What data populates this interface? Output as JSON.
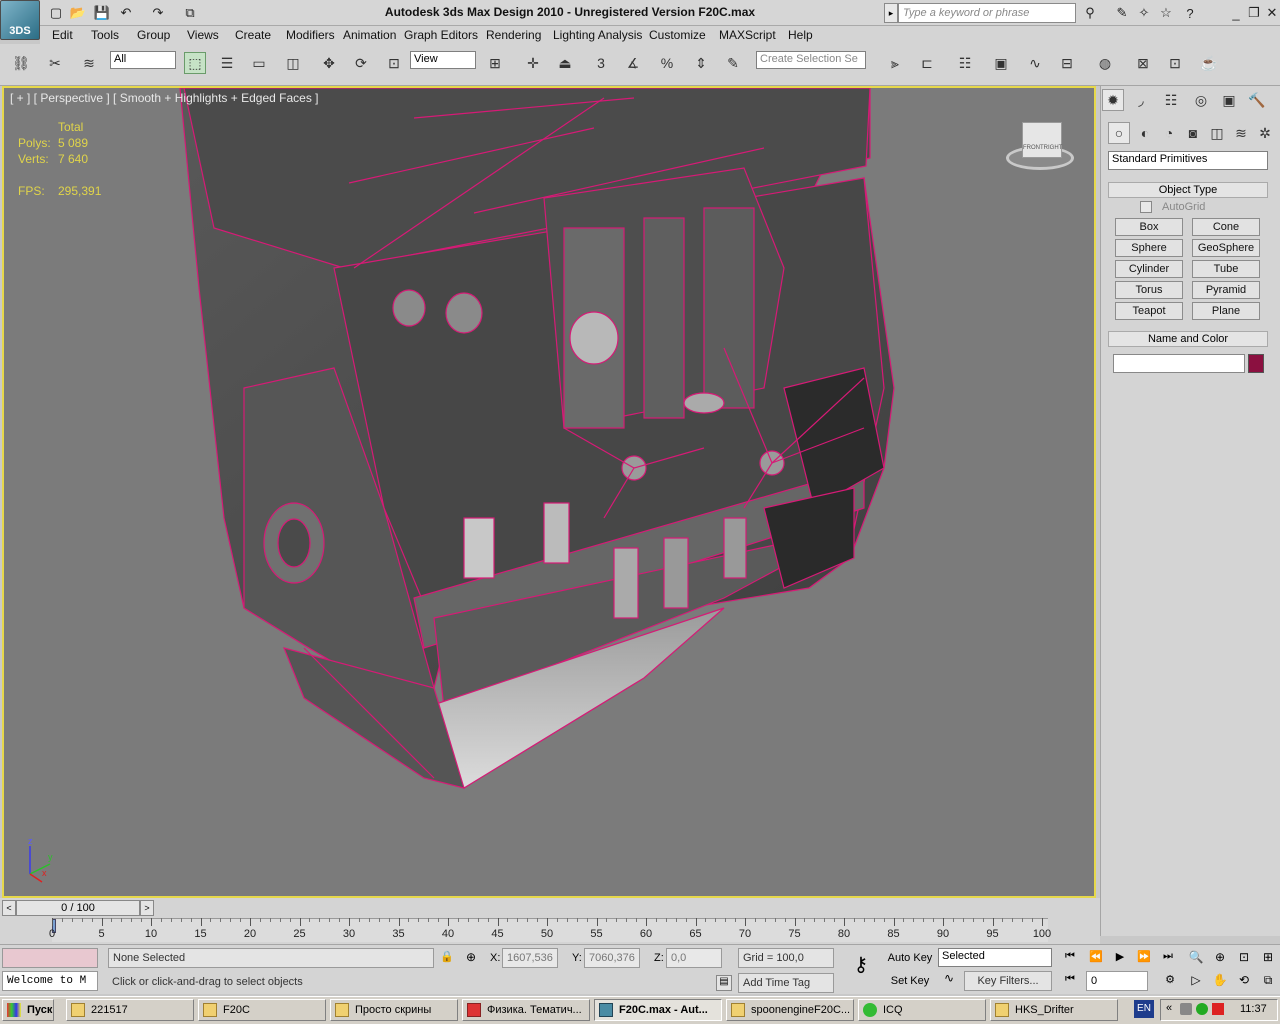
{
  "app": {
    "title": "Autodesk 3ds Max Design 2010  - Unregistered Version    F20C.max",
    "logo": "3DS",
    "search_placeholder": "Type a keyword or phrase"
  },
  "menu": [
    "Edit",
    "Tools",
    "Group",
    "Views",
    "Create",
    "Modifiers",
    "Animation",
    "Graph Editors",
    "Rendering",
    "Lighting Analysis",
    "Customize",
    "MAXScript",
    "Help"
  ],
  "toolbar": {
    "filter_value": "All",
    "refcoord_value": "View",
    "selection_set_placeholder": "Create Selection Se",
    "snap_label": "3",
    "angle_label": "%"
  },
  "viewport": {
    "label": "[ + ] [ Perspective ] [ Smooth + Highlights + Edged Faces ]",
    "stats": {
      "total_label": "Total",
      "polys_label": "Polys:",
      "polys_value": "5 089",
      "verts_label": "Verts:",
      "verts_value": "7 640",
      "fps_label": "FPS:",
      "fps_value": "295,391"
    },
    "viewcube_labels": [
      "FRONT",
      "RIGHT"
    ],
    "axis": {
      "x": "x",
      "y": "y",
      "z": "z"
    }
  },
  "command_panel": {
    "category": "Standard Primitives",
    "object_type_title": "Object Type",
    "autogrid_label": "AutoGrid",
    "buttons": [
      "Box",
      "Cone",
      "Sphere",
      "GeoSphere",
      "Cylinder",
      "Tube",
      "Torus",
      "Pyramid",
      "Teapot",
      "Plane"
    ],
    "name_color_title": "Name and Color",
    "name_value": "",
    "color": "#8b1040"
  },
  "timeline": {
    "frame_label": "0 / 100",
    "ticks": [
      "0",
      "5",
      "10",
      "15",
      "20",
      "25",
      "30",
      "35",
      "40",
      "45",
      "50",
      "55",
      "60",
      "65",
      "70",
      "75",
      "80",
      "85",
      "90",
      "95",
      "100"
    ]
  },
  "status": {
    "welcome": "Welcome to M",
    "selection": "None Selected",
    "prompt": "Click or click-and-drag to select objects",
    "x_label": "X:",
    "x_value": "1607,536",
    "y_label": "Y:",
    "y_value": "7060,376",
    "z_label": "Z:",
    "z_value": "0,0",
    "grid": "Grid = 100,0",
    "add_time_tag": "Add Time Tag",
    "auto_key": "Auto Key",
    "set_key": "Set Key",
    "key_mode_value": "Selected",
    "key_filters": "Key Filters...",
    "frame_value": "0"
  },
  "taskbar": {
    "start": "Пуск",
    "tasks": [
      "221517",
      "F20C",
      "Просто скрины",
      "Физика. Тематич...",
      "F20C.max - Aut...",
      "spoonengineF20C...",
      "ICQ",
      "HKS_Drifter"
    ],
    "lang": "EN",
    "clock": "11:37"
  }
}
